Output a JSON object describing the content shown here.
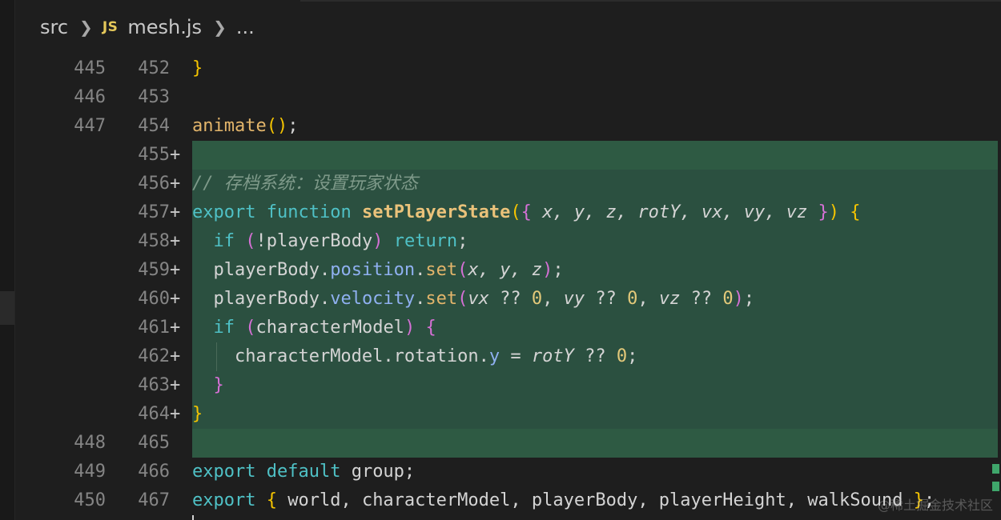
{
  "breadcrumb": {
    "folder": "src",
    "file_icon": "JS",
    "file": "mesh.js",
    "more": "..."
  },
  "lines": [
    {
      "old": "445",
      "new": "452",
      "added": false
    },
    {
      "old": "446",
      "new": "453",
      "added": false
    },
    {
      "old": "447",
      "new": "454",
      "added": false
    },
    {
      "old": "",
      "new": "455",
      "added": true
    },
    {
      "old": "",
      "new": "456",
      "added": true
    },
    {
      "old": "",
      "new": "457",
      "added": true
    },
    {
      "old": "",
      "new": "458",
      "added": true
    },
    {
      "old": "",
      "new": "459",
      "added": true
    },
    {
      "old": "",
      "new": "460",
      "added": true
    },
    {
      "old": "",
      "new": "461",
      "added": true
    },
    {
      "old": "",
      "new": "462",
      "added": true
    },
    {
      "old": "",
      "new": "463",
      "added": true
    },
    {
      "old": "",
      "new": "464",
      "added": true
    },
    {
      "old": "448",
      "new": "465",
      "added": false
    },
    {
      "old": "449",
      "new": "466",
      "added": false
    },
    {
      "old": "450",
      "new": "467",
      "added": false
    }
  ],
  "plus_marker": "+",
  "code": {
    "l452": "}",
    "l454_fn": "animate",
    "l454_paren": "()",
    "l454_semi": ";",
    "l456_comment": "// 存档系统：设置玩家状态",
    "l457_export": "export",
    "l457_function": "function",
    "l457_name": "setPlayerState",
    "l457_params": "x, y, z, rotY, vx, vy, vz",
    "l458_if": "if",
    "l458_cond": "!playerBody",
    "l458_return": "return",
    "l459_obj": "playerBody.",
    "l459_prop": "position",
    "l459_method": "set",
    "l459_args": "x, y, z",
    "l460_obj": "playerBody.",
    "l460_prop": "velocity",
    "l460_method": "set",
    "l461_if": "if",
    "l461_cond": "characterModel",
    "l462_obj": "characterModel.rotation.",
    "l462_prop": "y",
    "l462_op": " = ",
    "l462_val": "rotY",
    "l462_nc": " ?? ",
    "l462_zero": "0",
    "l466_export": "export",
    "l466_default": "default",
    "l466_rest": " group;",
    "l467_export": "export",
    "l467_names": " world, characterModel, playerBody, playerHeight, walkSound "
  },
  "watermark": "@稀土掘金技术社区"
}
